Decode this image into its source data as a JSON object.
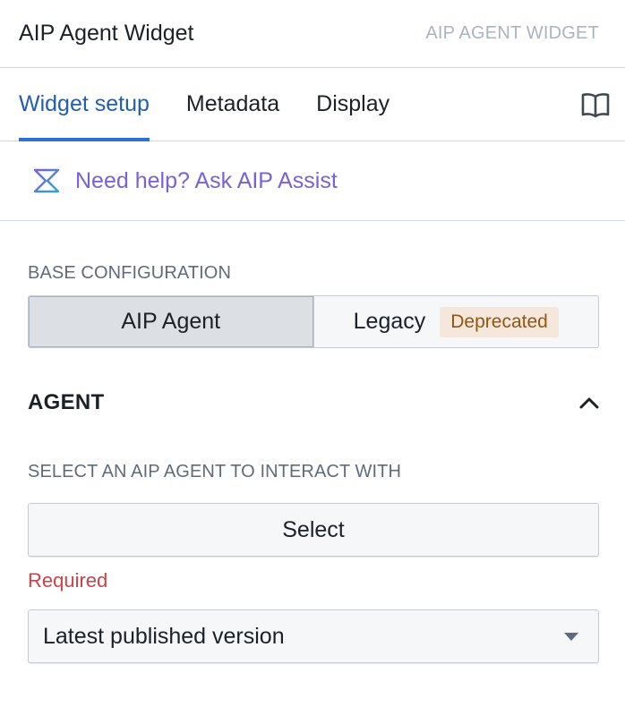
{
  "header": {
    "title": "AIP Agent Widget",
    "subtitle": "AIP AGENT WIDGET"
  },
  "tabs": [
    {
      "label": "Widget setup",
      "active": true
    },
    {
      "label": "Metadata",
      "active": false
    },
    {
      "label": "Display",
      "active": false
    }
  ],
  "docs_icon": "book-open-icon",
  "help": {
    "icon": "aip-assist-icon",
    "link_label": "Need help? Ask AIP Assist"
  },
  "base_configuration": {
    "label": "BASE CONFIGURATION",
    "options": [
      {
        "label": "AIP Agent",
        "selected": true
      },
      {
        "label": "Legacy",
        "selected": false,
        "badge": "Deprecated"
      }
    ]
  },
  "agent_section": {
    "title": "AGENT",
    "collapse_icon": "chevron-up-icon",
    "select_label": "SELECT AN AIP AGENT TO INTERACT WITH",
    "select_button": "Select",
    "error": "Required",
    "version_select": {
      "value": "Latest published version",
      "icon": "caret-down-icon"
    }
  },
  "colors": {
    "accent": "#2d72d2",
    "active_tab_text": "#215db0",
    "ai_purple": "#7961db",
    "danger": "#cd4246",
    "deprecated_bg": "#f5e7dc",
    "deprecated_text": "#935610"
  }
}
